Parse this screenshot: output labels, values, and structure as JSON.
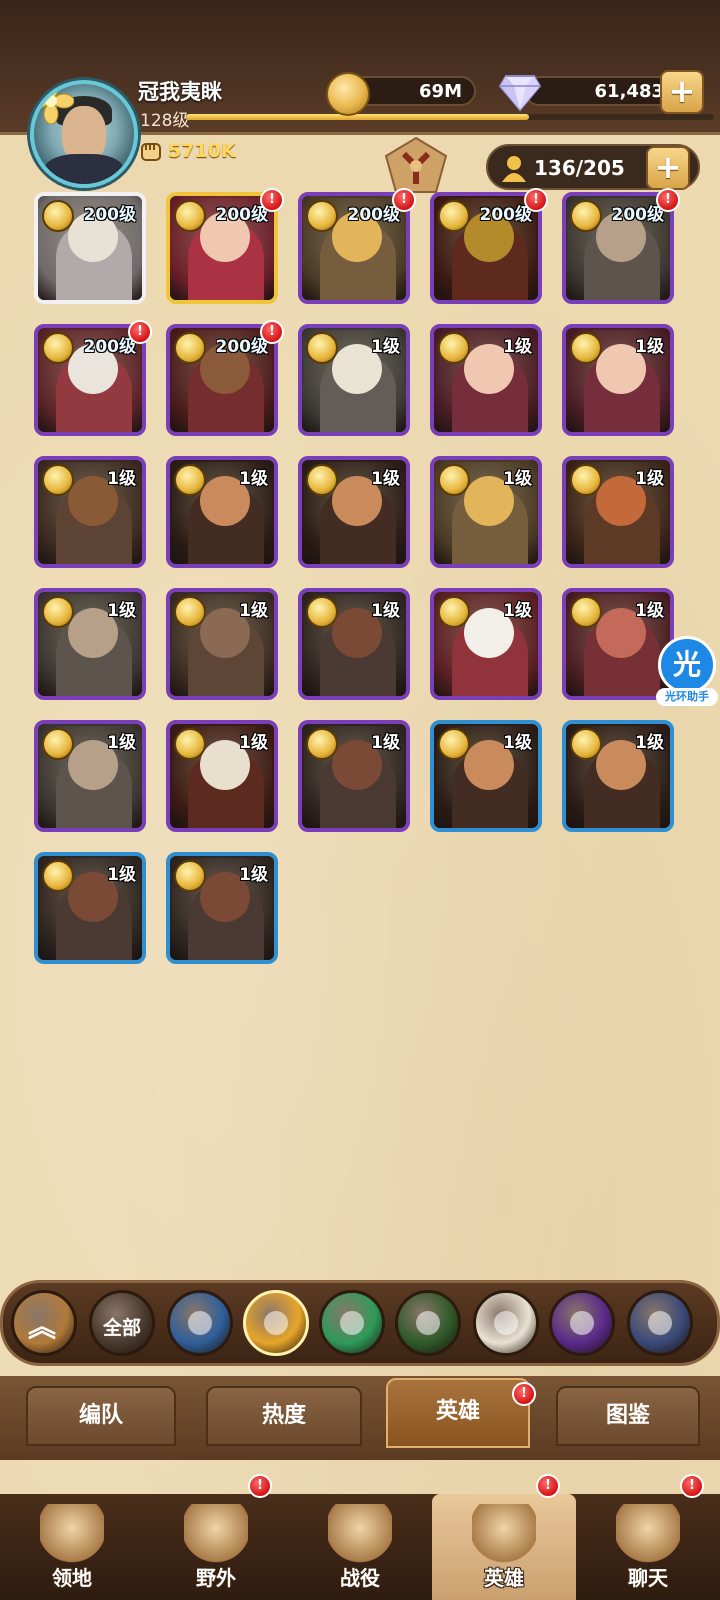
{
  "player": {
    "name": "冠我夷眯",
    "level": "128级",
    "power": "5710K",
    "xp_fraction": 0.65
  },
  "resources": {
    "gold": "69M",
    "diamonds": "61,483"
  },
  "hero_capacity": "136/205",
  "heroes": [
    {
      "level": "200级",
      "frame": "white",
      "alert": false,
      "tint": "#6f6a6a",
      "skin": "#e8e2d6"
    },
    {
      "level": "200级",
      "frame": "gold",
      "alert": true,
      "tint": "#6a1f2a",
      "skin": "#f0c7b0"
    },
    {
      "level": "200级",
      "frame": "purple",
      "alert": true,
      "tint": "#4a3a26",
      "skin": "#e2b55a"
    },
    {
      "level": "200级",
      "frame": "purple",
      "alert": true,
      "tint": "#3a1a12",
      "skin": "#b58a2a"
    },
    {
      "level": "200级",
      "frame": "purple",
      "alert": true,
      "tint": "#3a3530",
      "skin": "#b6a08a"
    },
    {
      "level": "200级",
      "frame": "purple",
      "alert": true,
      "tint": "#5b2428",
      "skin": "#e9e4dc"
    },
    {
      "level": "200级",
      "frame": "purple",
      "alert": true,
      "tint": "#4a1c1c",
      "skin": "#8a5a3a"
    },
    {
      "level": "1级",
      "frame": "purple",
      "alert": false,
      "tint": "#3d3a36",
      "skin": "#e9e3d4"
    },
    {
      "level": "1级",
      "frame": "purple",
      "alert": false,
      "tint": "#4a1d26",
      "skin": "#f0c7b0"
    },
    {
      "level": "1级",
      "frame": "purple",
      "alert": false,
      "tint": "#4a1d26",
      "skin": "#f0c7b0"
    },
    {
      "level": "1级",
      "frame": "purple",
      "alert": false,
      "tint": "#3a2a20",
      "skin": "#8a5a36"
    },
    {
      "level": "1级",
      "frame": "purple",
      "alert": false,
      "tint": "#2a1c16",
      "skin": "#c98b5c"
    },
    {
      "level": "1级",
      "frame": "purple",
      "alert": false,
      "tint": "#2a1c16",
      "skin": "#c98b5c"
    },
    {
      "level": "1级",
      "frame": "purple",
      "alert": false,
      "tint": "#4a3a26",
      "skin": "#e2b55a"
    },
    {
      "level": "1级",
      "frame": "purple",
      "alert": false,
      "tint": "#3a2418",
      "skin": "#c46a3a"
    },
    {
      "level": "1级",
      "frame": "purple",
      "alert": false,
      "tint": "#3a3530",
      "skin": "#b6a08a"
    },
    {
      "level": "1级",
      "frame": "purple",
      "alert": false,
      "tint": "#3a2c22",
      "skin": "#8a6a52"
    },
    {
      "level": "1级",
      "frame": "purple",
      "alert": false,
      "tint": "#2e2420",
      "skin": "#7a4a36"
    },
    {
      "level": "1级",
      "frame": "purple",
      "alert": false,
      "tint": "#5a2024",
      "skin": "#f2efe8"
    },
    {
      "level": "1级",
      "frame": "purple",
      "alert": false,
      "tint": "#4a1e22",
      "skin": "#c46a5a"
    },
    {
      "level": "1级",
      "frame": "purple",
      "alert": false,
      "tint": "#3a3530",
      "skin": "#b6a08a"
    },
    {
      "level": "1级",
      "frame": "purple",
      "alert": false,
      "tint": "#3a1a14",
      "skin": "#e8e0cc"
    },
    {
      "level": "1级",
      "frame": "purple",
      "alert": false,
      "tint": "#2e2420",
      "skin": "#7a4a36"
    },
    {
      "level": "1级",
      "frame": "blue",
      "alert": false,
      "tint": "#2a1c16",
      "skin": "#c98b5c"
    },
    {
      "level": "1级",
      "frame": "blue",
      "alert": false,
      "tint": "#2a1c16",
      "skin": "#c98b5c"
    },
    {
      "level": "1级",
      "frame": "blue",
      "alert": false,
      "tint": "#2e2420",
      "skin": "#7a4a36"
    },
    {
      "level": "1级",
      "frame": "blue",
      "alert": false,
      "tint": "#2e2420",
      "skin": "#7a4a36"
    }
  ],
  "helper": {
    "glyph": "光",
    "caption": "光环助手"
  },
  "filters": [
    {
      "name": "collapse",
      "label": "",
      "color": "#b07a3a",
      "icon": "double-chevron-up-icon"
    },
    {
      "name": "all",
      "label": "全部",
      "color": "#4a3a2e",
      "icon": ""
    },
    {
      "name": "lightbearer",
      "label": "",
      "color": "#2f5f9a",
      "icon": "compass-star-icon"
    },
    {
      "name": "mauler",
      "label": "",
      "color": "#e7a52a",
      "icon": "mauler-emblem-icon"
    },
    {
      "name": "wilder",
      "label": "",
      "color": "#2f9a5a",
      "icon": "leaf-icon"
    },
    {
      "name": "graveborn",
      "label": "",
      "color": "#2f5a2a",
      "icon": "eye-icon"
    },
    {
      "name": "celestial",
      "label": "",
      "color": "#e9e2d2",
      "icon": "sun-star-icon"
    },
    {
      "name": "hypogean",
      "label": "",
      "color": "#5a2a8a",
      "icon": "dark-crystal-icon"
    },
    {
      "name": "dimensional",
      "label": "",
      "color": "#3a4a7a",
      "icon": "portal-ring-icon"
    }
  ],
  "tabs": [
    {
      "label": "编队",
      "active": false,
      "alert": false
    },
    {
      "label": "热度",
      "active": false,
      "alert": false
    },
    {
      "label": "英雄",
      "active": true,
      "alert": true
    },
    {
      "label": "图鉴",
      "active": false,
      "alert": false
    }
  ],
  "bottom_nav": [
    {
      "label": "领地",
      "icon": "castle-icon",
      "active": false,
      "alert": false
    },
    {
      "label": "野外",
      "icon": "scroll-map-icon",
      "active": false,
      "alert": true
    },
    {
      "label": "战役",
      "icon": "crossed-swords-icon",
      "active": false,
      "alert": false
    },
    {
      "label": "英雄",
      "icon": "helmet-icon",
      "active": true,
      "alert": true
    },
    {
      "label": "聊天",
      "icon": "chat-bubble-icon",
      "active": false,
      "alert": true
    }
  ],
  "colors": {
    "alert_red": "#d41515",
    "parchment": "#ecd9b0",
    "gold_text": "#ffd75a"
  }
}
